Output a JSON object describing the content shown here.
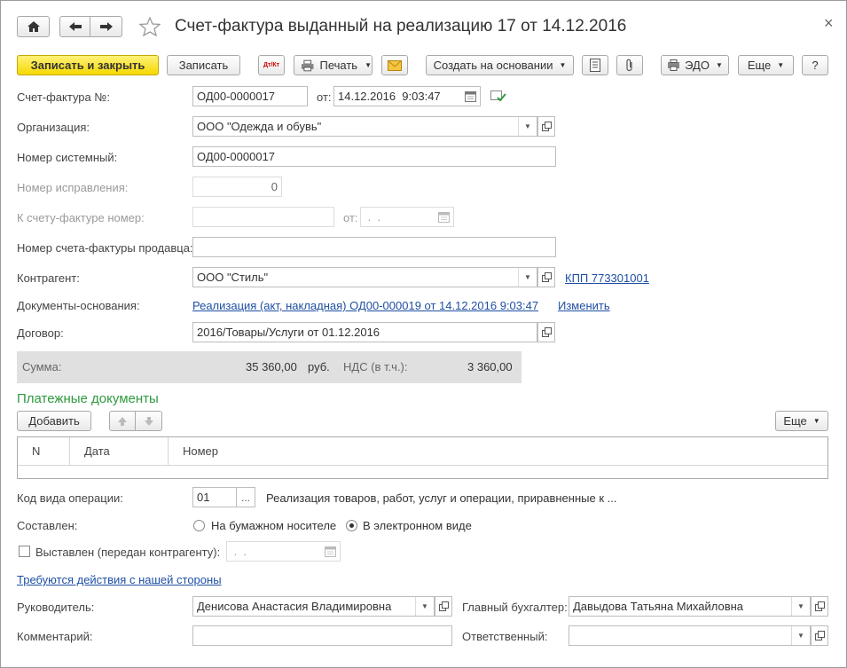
{
  "header": {
    "title": "Счет-фактура выданный на реализацию 17 от 14.12.2016",
    "close_glyph": "×"
  },
  "toolbar": {
    "save_close": "Записать и закрыть",
    "save": "Записать",
    "dtkt": "Дт/Кт",
    "print": "Печать",
    "create_based": "Создать на основании",
    "edo": "ЭДО",
    "more": "Еще",
    "help": "?"
  },
  "form": {
    "invoice_label": "Счет-фактура №:",
    "invoice_number": "ОД00-0000017",
    "from_label": "от:",
    "invoice_date": "14.12.2016  9:03:47",
    "org_label": "Организация:",
    "org_value": "ООО \"Одежда и обувь\"",
    "sysnum_label": "Номер системный:",
    "sysnum_value": "ОД00-0000017",
    "corr_label": "Номер исправления:",
    "corr_value": "0",
    "toinv_label": "К счету-фактуре номер:",
    "toinv_value": "",
    "toinv_from_label": "от:",
    "toinv_date": " .  .",
    "seller_num_label": "Номер счета-фактуры продавца:",
    "seller_num_value": "",
    "contractor_label": "Контрагент:",
    "contractor_value": "ООО \"Стиль\"",
    "kpp_link": "КПП 773301001",
    "base_docs_label": "Документы-основания:",
    "base_docs_link": "Реализация (акт, накладная) ОД00-000019 от 14.12.2016 9:03:47",
    "change_link": "Изменить",
    "contract_label": "Договор:",
    "contract_value": "2016/Товары/Услуги от 01.12.2016"
  },
  "sum": {
    "label": "Сумма:",
    "amount": "35 360,00",
    "currency": "руб.",
    "vat_label": "НДС (в т.ч.):",
    "vat_amount": "3 360,00"
  },
  "payments": {
    "title": "Платежные документы",
    "add": "Добавить",
    "more": "Еще",
    "columns": [
      "N",
      "Дата",
      "Номер"
    ]
  },
  "operation": {
    "code_label": "Код вида операции:",
    "code_value": "01",
    "code_btn": "...",
    "code_desc": "Реализация товаров, работ, услуг и операции, приравненные к ...",
    "composed_label": "Составлен:",
    "paper": "На бумажном носителе",
    "electronic": "В электронном виде",
    "issued_label": "Выставлен (передан контрагенту):",
    "issued_date": " .  .",
    "actions_link": "Требуются действия с нашей стороны"
  },
  "signers": {
    "head_label": "Руководитель:",
    "head_value": "Денисова Анастасия Владимировна",
    "accountant_label": "Главный бухгалтер:",
    "accountant_value": "Давыдова Татьяна Михайловна",
    "comment_label": "Комментарий:",
    "comment_value": "",
    "responsible_label": "Ответственный:",
    "responsible_value": ""
  },
  "colors": {
    "accent_yellow": "#f5d800",
    "link": "#1f4fa3",
    "section_green": "#2e9a3e",
    "sum_bg": "#e0e0e0"
  }
}
